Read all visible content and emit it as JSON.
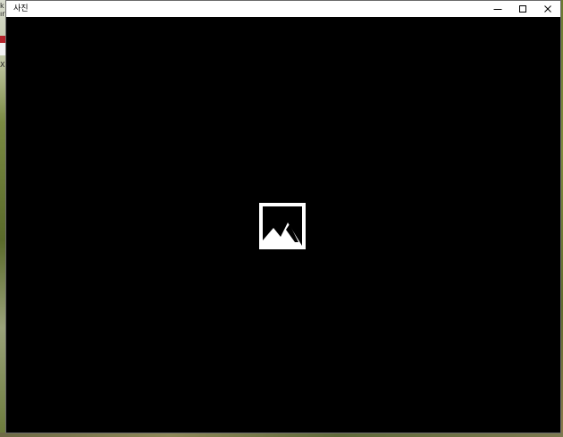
{
  "window": {
    "title": "사진"
  },
  "desktop": {
    "fragment_1": "k",
    "fragment_2": "ır",
    "fragment_3": "X"
  },
  "caption_buttons": {
    "minimize_icon": "minimize-icon",
    "maximize_icon": "maximize-icon",
    "close_icon": "close-icon"
  },
  "content": {
    "background": "#000000",
    "placeholder_icon": "image-placeholder-icon",
    "icon_color": "#ffffff"
  }
}
